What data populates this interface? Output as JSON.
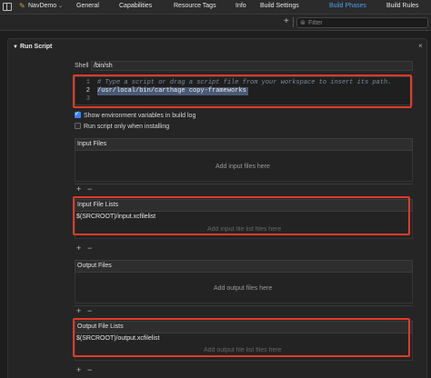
{
  "toolbar": {
    "target_name": "NavDemo",
    "tabs": [
      "General",
      "Capabilities",
      "Resource Tags",
      "Info",
      "Build Settings",
      "Build Phases",
      "Build Rules"
    ],
    "active_tab": "Build Phases",
    "filter_placeholder": "Filter",
    "add_symbol": "+"
  },
  "run_script": {
    "title": "Run Script",
    "close_symbol": "×",
    "shell_label": "Shell",
    "shell_value": "/bin/sh",
    "code_lines": [
      {
        "number": "1",
        "text": "# Type a script or drag a script file from your workspace to insert its path."
      },
      {
        "number": "2",
        "text": "/usr/local/bin/carthage copy-frameworks"
      },
      {
        "number": "3",
        "text": ""
      }
    ],
    "show_env_label": "Show environment variables in build log",
    "show_env_checked": true,
    "run_only_installing_label": "Run script only when installing",
    "run_only_installing_checked": false
  },
  "input_files": {
    "header": "Input Files",
    "placeholder": "Add input files here"
  },
  "input_file_lists": {
    "header": "Input File Lists",
    "items": [
      "$(SRCROOT)/input.xcfilelist"
    ],
    "placeholder": "Add input file list files here"
  },
  "output_files": {
    "header": "Output Files",
    "placeholder": "Add output files here"
  },
  "output_file_lists": {
    "header": "Output File Lists",
    "items": [
      "$(SRCROOT)/output.xcfilelist"
    ],
    "placeholder": "Add output file list files here"
  },
  "controls": {
    "add_symbol": "+",
    "remove_symbol": "−"
  },
  "colors": {
    "accent": "#4a9ff5",
    "highlight_outline": "#e23a2a"
  }
}
